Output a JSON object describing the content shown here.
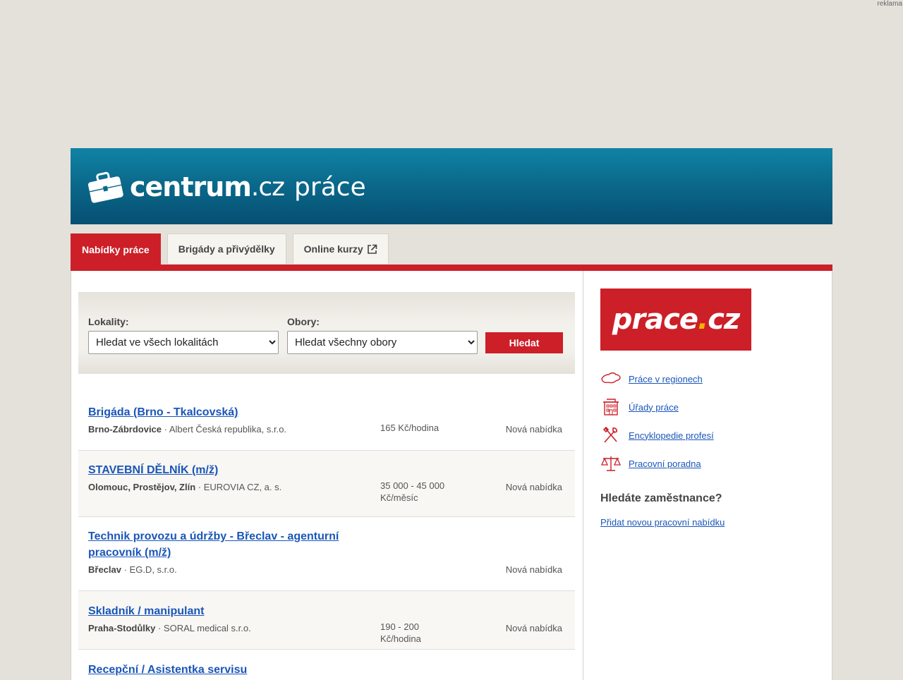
{
  "ad": {
    "label": "reklama"
  },
  "header": {
    "brand": "centrum",
    "brand_suffix": ".cz",
    "section": "práce"
  },
  "tabs": [
    {
      "label": "Nabídky práce",
      "active": true
    },
    {
      "label": "Brigády a přivýdělky",
      "active": false
    },
    {
      "label": "Online kurzy",
      "active": false,
      "icon": "external-link-icon"
    }
  ],
  "search": {
    "locations_label": "Lokality:",
    "locations_value": "Hledat ve všech lokalitách",
    "fields_label": "Obory:",
    "fields_value": "Hledat všechny obory",
    "button_label": "Hledat"
  },
  "jobs": [
    {
      "title": "Brigáda (Brno - Tkalcovská)",
      "location": "Brno-Zábrdovice",
      "company": " · Albert Česká republika, s.r.o.",
      "salary": "165 Kč/hodina",
      "status": "Nová nabídka"
    },
    {
      "title": "STAVEBNÍ DĚLNÍK (m/ž)",
      "location": "Olomouc, Prostějov, Zlín",
      "company": " · EUROVIA CZ, a. s.",
      "salary": "35 000 - 45 000 Kč/měsíc",
      "status": "Nová nabídka"
    },
    {
      "title": "Technik provozu a údržby - Břeclav - agenturní pracovník (m/ž)",
      "location": "Břeclav",
      "company": " · EG.D, s.r.o.",
      "salary": "",
      "status": "Nová nabídka"
    },
    {
      "title": "Skladník / manipulant",
      "location": "Praha-Stodůlky",
      "company": " · SORAL medical s.r.o.",
      "salary": "190 - 200 Kč/hodina",
      "status": "Nová nabídka"
    },
    {
      "title": "Recepční / Asistentka servisu",
      "location": "",
      "company": "",
      "salary": "",
      "status": ""
    }
  ],
  "sidebar": {
    "logo_text": "prace",
    "logo_dot": ".",
    "logo_suffix": "cz",
    "links": [
      {
        "label": "Práce v regionech",
        "icon": "map-icon"
      },
      {
        "label": "Úřady práce",
        "icon": "building-icon"
      },
      {
        "label": "Encyklopedie profesí",
        "icon": "tools-icon"
      },
      {
        "label": "Pracovní poradna",
        "icon": "scales-icon"
      }
    ],
    "employer_heading": "Hledáte zaměstnance?",
    "employer_link": "Přidat novou pracovní nabídku"
  },
  "colors": {
    "accent_red": "#cc1f28",
    "header_blue": "#0b6a8c",
    "link_blue": "#1a56b8",
    "page_bg": "#e4e1da"
  }
}
